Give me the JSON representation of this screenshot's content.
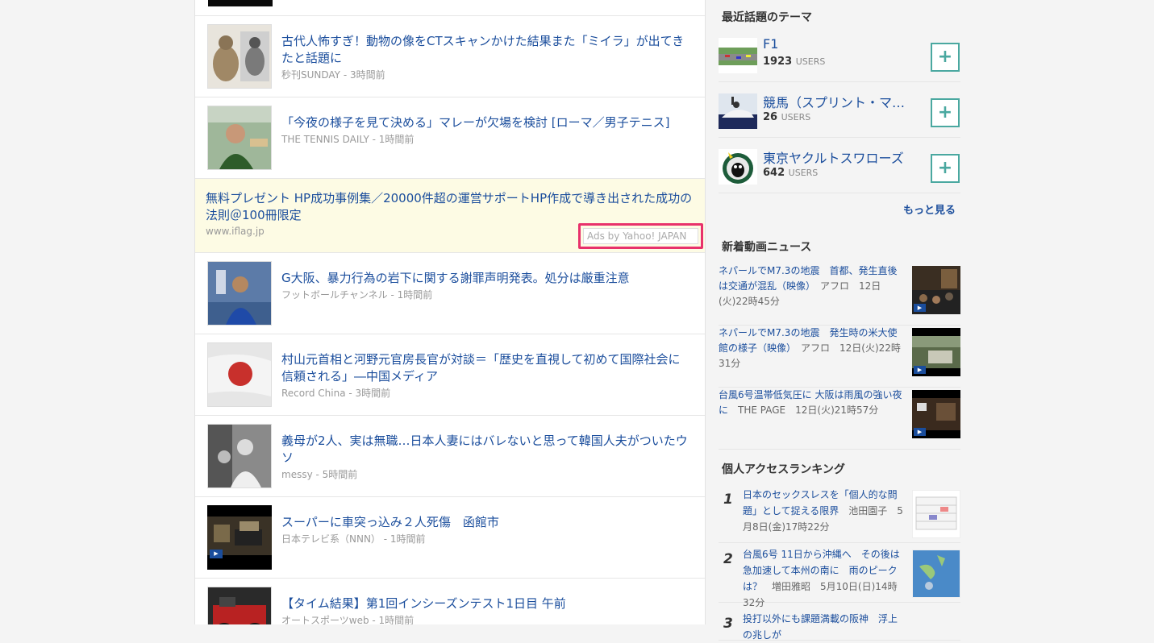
{
  "feed": {
    "articles": [
      {
        "title": "古代人怖すぎ！動物の像をCTスキャンかけた結果また「ミイラ」が出てきたと話題に",
        "source": "秒刊SUNDAY",
        "time": "3時間前"
      },
      {
        "title": "「今夜の様子を見て決める」マレーが欠場を検討 [ローマ／男子テニス]",
        "source": "THE TENNIS DAILY",
        "time": "1時間前"
      },
      {
        "title": "G大阪、暴力行為の岩下に関する謝罪声明発表。処分は厳重注意",
        "source": "フットボールチャンネル",
        "time": "1時間前"
      },
      {
        "title": "村山元首相と河野元官房長官が対談＝「歴史を直視して初めて国際社会に信頼される」―中国メディア",
        "source": "Record China",
        "time": "3時間前"
      },
      {
        "title": "義母が2人、実は無職…日本人妻にはバレないと思って韓国人夫がついたウソ",
        "source": "messy",
        "time": "5時間前"
      },
      {
        "title": "スーパーに車突っ込み２人死傷　函館市",
        "source": "日本テレビ系（NNN）",
        "time": "1時間前"
      },
      {
        "title": "【タイム結果】第1回インシーズンテスト1日目 午前",
        "source": "オートスポーツweb",
        "time": "1時間前"
      }
    ],
    "ad": {
      "title": "無料プレゼント HP成功事例集／20000件超の運営サポートHP作成で導き出された成功の法則＠100冊限定",
      "url": "www.iflag.jp",
      "label": "Ads by Yahoo! JAPAN"
    },
    "meta_sep": " - "
  },
  "sidebar": {
    "themes_title": "最近話題のテーマ",
    "themes": [
      {
        "name": "F1",
        "count": "1923",
        "unit": "USERS"
      },
      {
        "name": "競馬（スプリント・マ…",
        "count": "26",
        "unit": "USERS"
      },
      {
        "name": "東京ヤクルトスワローズ",
        "count": "642",
        "unit": "USERS"
      }
    ],
    "plus_label": "+",
    "more_label": "もっと見る",
    "video_title": "新着動画ニュース",
    "videos": [
      {
        "title": "ネパールでM7.3の地震　首都、発生直後は交通が混乱（映像）",
        "meta": "アフロ　12日(火)22時45分"
      },
      {
        "title": "ネパールでM7.3の地震　発生時の米大使館の様子（映像）",
        "meta": "アフロ　12日(火)22時31分"
      },
      {
        "title": "台風6号温帯低気圧に 大阪は雨風の強い夜に",
        "meta": "THE PAGE　12日(火)21時57分"
      }
    ],
    "ranking_title": "個人アクセスランキング",
    "ranking": [
      {
        "num": "1",
        "title": "日本のセックスレスを「個人的な問題」として捉える限界",
        "meta": "池田園子　5月8日(金)17時22分"
      },
      {
        "num": "2",
        "title": "台風6号 11日から沖縄へ　その後は急加速して本州の南に　雨のピークは？",
        "meta": "増田雅昭　5月10日(日)14時32分"
      },
      {
        "num": "3",
        "title": "投打以外にも課題満載の阪神　浮上の兆しが",
        "meta": ""
      }
    ]
  },
  "colors": {
    "link": "#1a4d9c",
    "ad_bg": "#fdfbe4",
    "ad_highlight": "#e8316b",
    "plus": "#4aa8a0"
  }
}
